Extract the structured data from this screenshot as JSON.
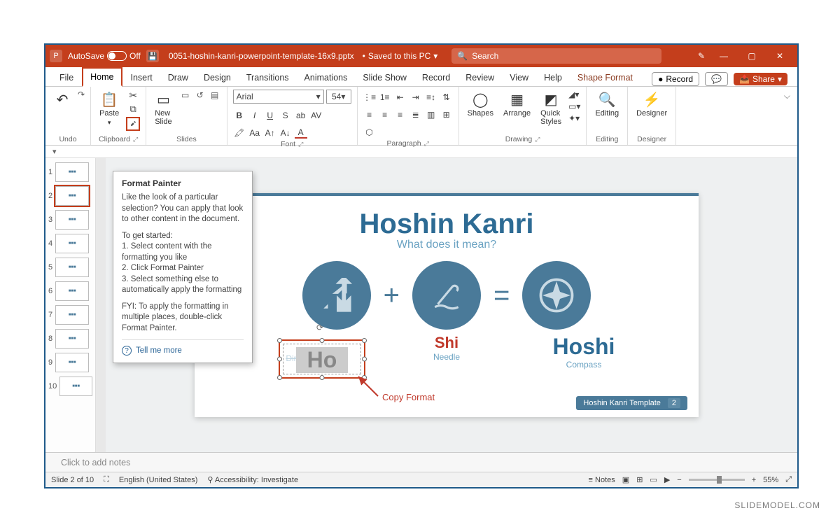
{
  "titlebar": {
    "autosave_label": "AutoSave",
    "autosave_state": "Off",
    "filename": "0051-hoshin-kanri-powerpoint-template-16x9.pptx",
    "save_status": "Saved to this PC",
    "search_placeholder": "Search"
  },
  "tabs": {
    "items": [
      "File",
      "Home",
      "Insert",
      "Draw",
      "Design",
      "Transitions",
      "Animations",
      "Slide Show",
      "Record",
      "Review",
      "View",
      "Help",
      "Shape Format"
    ],
    "active": "Home",
    "record_btn": "Record",
    "share_btn": "Share"
  },
  "ribbon": {
    "undo": "Undo",
    "clipboard": {
      "paste": "Paste",
      "label": "Clipboard"
    },
    "slides": {
      "new_slide": "New\nSlide",
      "label": "Slides"
    },
    "font": {
      "name": "Arial",
      "size": "54",
      "label": "Font"
    },
    "paragraph": {
      "label": "Paragraph"
    },
    "drawing": {
      "shapes": "Shapes",
      "arrange": "Arrange",
      "quick": "Quick\nStyles",
      "label": "Drawing"
    },
    "editing": {
      "label": "Editing",
      "btn": "Editing"
    },
    "designer": {
      "label": "Designer",
      "btn": "Designer"
    }
  },
  "tooltip": {
    "title": "Format Painter",
    "p1": "Like the look of a particular selection? You can apply that look to other content in the document.",
    "p2": "To get started:\n1. Select content with the formatting you like\n2. Click Format Painter\n3. Select something else to automatically apply the formatting",
    "p3": "FYI: To apply the formatting in multiple places, double-click Format Painter.",
    "tellme": "Tell me more"
  },
  "slide": {
    "title": "Hoshin Kanri",
    "subtitle": "What does it mean?",
    "ho": "Ho",
    "ho_sub": "Direction",
    "shi": "Shi",
    "shi_sub": "Needle",
    "hoshi": "Hoshi",
    "hoshi_sub": "Compass",
    "footer_label": "Hoshin Kanri Template",
    "footer_page": "2"
  },
  "annotation": {
    "copy_format": "Copy Format"
  },
  "thumbnails": {
    "count": 10,
    "active": 2
  },
  "notes": {
    "placeholder": "Click to add notes"
  },
  "statusbar": {
    "slide": "Slide 2 of 10",
    "lang": "English (United States)",
    "access": "Accessibility: Investigate",
    "notes_btn": "Notes",
    "zoom": "55%"
  },
  "watermark": "SLIDEMODEL.COM"
}
